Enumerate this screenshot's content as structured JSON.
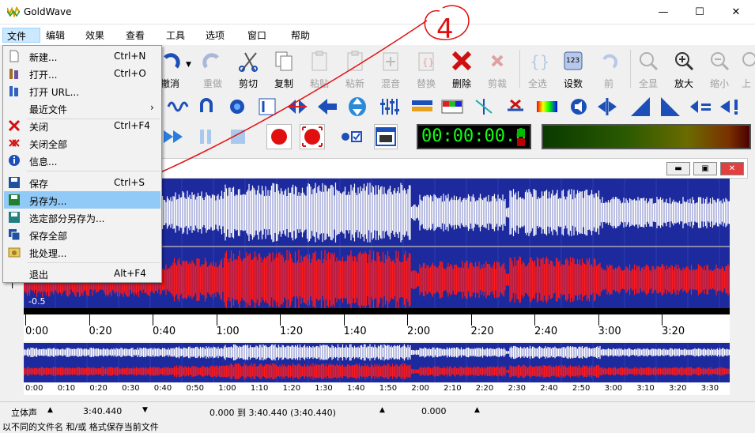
{
  "app": {
    "title": "GoldWave"
  },
  "window_controls": {
    "minimize": "—",
    "maximize": "☐",
    "close": "✕"
  },
  "menubar": [
    "文件",
    "编辑",
    "效果",
    "查看",
    "工具",
    "选项",
    "窗口",
    "帮助"
  ],
  "toolbar": {
    "buttons": [
      {
        "label": "撤消",
        "icon": "undo-icon",
        "enabled": true
      },
      {
        "label": "重做",
        "icon": "redo-icon",
        "enabled": false
      },
      {
        "label": "剪切",
        "icon": "scissors-icon",
        "enabled": true
      },
      {
        "label": "复制",
        "icon": "copy-icon",
        "enabled": true
      },
      {
        "label": "粘贴",
        "icon": "paste-icon",
        "enabled": false
      },
      {
        "label": "粘新",
        "icon": "paste-new-icon",
        "enabled": false
      },
      {
        "label": "混音",
        "icon": "mix-icon",
        "enabled": false
      },
      {
        "label": "替换",
        "icon": "replace-icon",
        "enabled": false
      },
      {
        "label": "删除",
        "icon": "delete-icon",
        "enabled": true
      },
      {
        "label": "剪裁",
        "icon": "trim-icon",
        "enabled": false
      },
      {
        "label": "全选",
        "icon": "select-all-icon",
        "enabled": false
      },
      {
        "label": "设数",
        "icon": "set-marker-icon",
        "enabled": true
      },
      {
        "label": "前",
        "icon": "previous-icon",
        "enabled": false
      },
      {
        "label": "全显",
        "icon": "zoom-all-icon",
        "enabled": false
      },
      {
        "label": "放大",
        "icon": "zoom-in-icon",
        "enabled": true
      },
      {
        "label": "缩小",
        "icon": "zoom-out-icon",
        "enabled": false
      },
      {
        "label": "上",
        "icon": "up-icon",
        "enabled": false
      }
    ]
  },
  "transport": {
    "counter": "00:00:00.0"
  },
  "file_menu": {
    "items": [
      {
        "label": "新建...",
        "shortcut": "Ctrl+N",
        "icon": "new-file-icon"
      },
      {
        "label": "打开...",
        "shortcut": "Ctrl+O",
        "icon": "open-icon"
      },
      {
        "label": "打开 URL...",
        "shortcut": "",
        "icon": "open-url-icon"
      },
      {
        "label": "最近文件",
        "shortcut": "",
        "icon": "",
        "submenu": "›"
      },
      {
        "label": "关闭",
        "shortcut": "Ctrl+F4",
        "icon": "close-red-icon"
      },
      {
        "label": "关闭全部",
        "shortcut": "",
        "icon": "close-all-icon"
      },
      {
        "label": "信息...",
        "shortcut": "",
        "icon": "info-icon"
      },
      {
        "label": "保存",
        "shortcut": "Ctrl+S",
        "icon": "save-icon"
      },
      {
        "label": "另存为...",
        "shortcut": "",
        "icon": "save-as-icon",
        "highlighted": true
      },
      {
        "label": "选定部分另存为...",
        "shortcut": "",
        "icon": "save-selection-icon"
      },
      {
        "label": "保存全部",
        "shortcut": "",
        "icon": "save-all-icon"
      },
      {
        "label": "批处理...",
        "shortcut": "",
        "icon": "batch-icon"
      },
      {
        "label": "退出",
        "shortcut": "Alt+F4",
        "icon": ""
      }
    ]
  },
  "wave": {
    "scale": [
      "-0.5"
    ]
  },
  "timeline": {
    "labels": [
      "0:00",
      "0:20",
      "0:40",
      "1:00",
      "1:20",
      "1:40",
      "2:00",
      "2:20",
      "2:40",
      "3:00",
      "3:20"
    ]
  },
  "overview": {
    "labels": [
      "0:00",
      "0:10",
      "0:20",
      "0:30",
      "0:40",
      "0:50",
      "1:00",
      "1:10",
      "1:20",
      "1:30",
      "1:40",
      "1:50",
      "2:00",
      "2:10",
      "2:20",
      "2:30",
      "2:40",
      "2:50",
      "3:00",
      "3:10",
      "3:20",
      "3:30"
    ]
  },
  "status": {
    "channel": "立体声",
    "length": "3:40.440",
    "selection": "0.000 到 3:40.440 (3:40.440)",
    "position": "0.000",
    "hint": "以不同的文件名 和/或 格式保存当前文件"
  },
  "annotation": {
    "number": "4"
  },
  "colors": {
    "wave_bg": "#1c2a9e",
    "left_channel": "#ffffff",
    "right_channel": "#ff1a1a",
    "menu_highlight": "#91c9f7",
    "annotation": "#e01010"
  }
}
